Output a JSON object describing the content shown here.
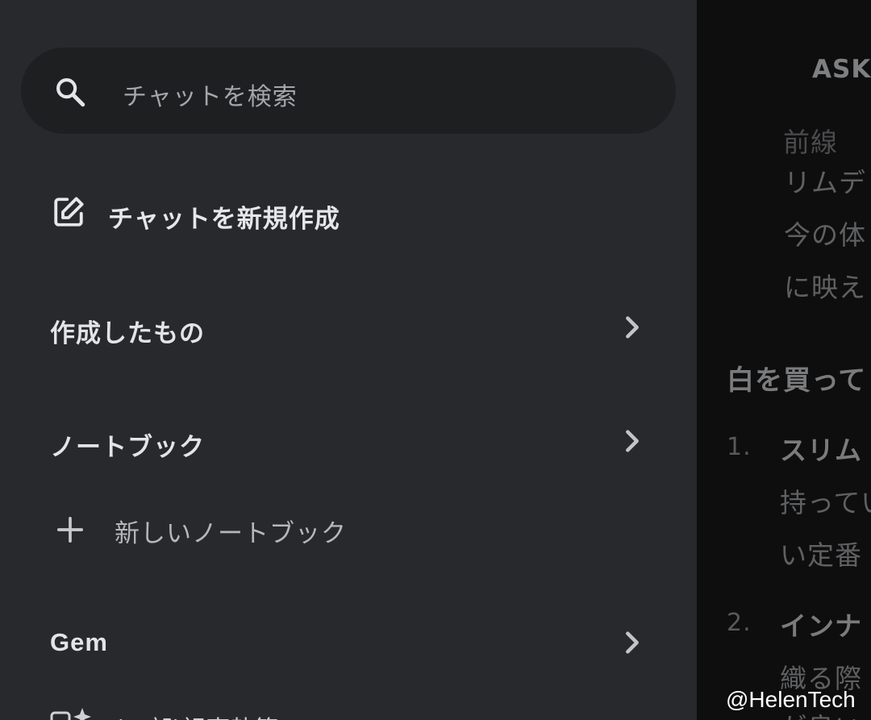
{
  "sidebar": {
    "search": {
      "placeholder": "チャットを検索",
      "icon": "search-icon"
    },
    "new_chat": {
      "label": "チャットを新規作成",
      "icon": "edit-icon"
    },
    "sections": [
      {
        "label": "作成したもの",
        "icon": "chevron-right-icon"
      },
      {
        "label": "ノートブック",
        "icon": "chevron-right-icon"
      },
      {
        "label": "Gem",
        "icon": "chevron-right-icon"
      }
    ],
    "new_notebook": {
      "label": "新しいノートブック",
      "icon": "plus-icon"
    },
    "gem_item": {
      "label": "(一部)記事執筆の"
    }
  },
  "content": {
    "header": "ASKI",
    "lines": [
      "リムデ",
      "今の体",
      "に映え"
    ],
    "section_heading": "白を買って",
    "list": [
      {
        "number": "1.",
        "title": "スリム",
        "lines": [
          "持ってい",
          "い定番"
        ]
      },
      {
        "number": "2.",
        "title": "インナ",
        "lines": [
          "織る際",
          "が良い"
        ]
      }
    ]
  },
  "watermark": "@HelenTech",
  "colors": {
    "sidebar_bg": "#28292c",
    "search_bg": "#1e1f21",
    "content_bg": "#0e0e0e"
  }
}
